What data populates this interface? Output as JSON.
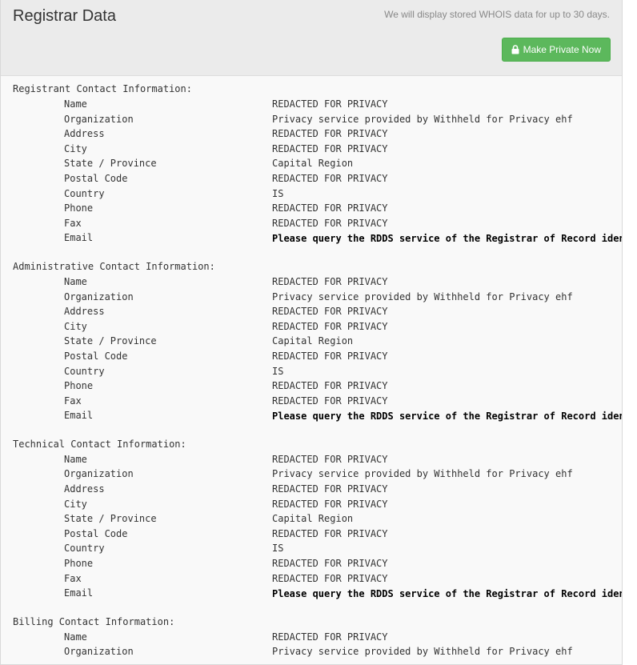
{
  "header": {
    "title": "Registrar Data",
    "note": "We will display stored WHOIS data for up to 30 days.",
    "button_label": "Make Private Now"
  },
  "sections": [
    {
      "title": "Registrant Contact Information:",
      "rows": [
        {
          "label": "Name",
          "value": "REDACTED FOR PRIVACY"
        },
        {
          "label": "Organization",
          "value": "Privacy service provided by Withheld for Privacy ehf"
        },
        {
          "label": "Address",
          "value": "REDACTED FOR PRIVACY"
        },
        {
          "label": "City",
          "value": "REDACTED FOR PRIVACY"
        },
        {
          "label": "State / Province",
          "value": "Capital Region"
        },
        {
          "label": "Postal Code",
          "value": "REDACTED FOR PRIVACY"
        },
        {
          "label": "Country",
          "value": "IS"
        },
        {
          "label": "Phone",
          "value": "REDACTED FOR PRIVACY"
        },
        {
          "label": "Fax",
          "value": "REDACTED FOR PRIVACY"
        },
        {
          "label": "Email",
          "value": "Please query the RDDS service of the Registrar of Record identifi"
        }
      ]
    },
    {
      "title": "Administrative Contact Information:",
      "rows": [
        {
          "label": "Name",
          "value": "REDACTED FOR PRIVACY"
        },
        {
          "label": "Organization",
          "value": "Privacy service provided by Withheld for Privacy ehf"
        },
        {
          "label": "Address",
          "value": "REDACTED FOR PRIVACY"
        },
        {
          "label": "City",
          "value": "REDACTED FOR PRIVACY"
        },
        {
          "label": "State / Province",
          "value": "Capital Region"
        },
        {
          "label": "Postal Code",
          "value": "REDACTED FOR PRIVACY"
        },
        {
          "label": "Country",
          "value": "IS"
        },
        {
          "label": "Phone",
          "value": "REDACTED FOR PRIVACY"
        },
        {
          "label": "Fax",
          "value": "REDACTED FOR PRIVACY"
        },
        {
          "label": "Email",
          "value": "Please query the RDDS service of the Registrar of Record identifi"
        }
      ]
    },
    {
      "title": "Technical Contact Information:",
      "rows": [
        {
          "label": "Name",
          "value": "REDACTED FOR PRIVACY"
        },
        {
          "label": "Organization",
          "value": "Privacy service provided by Withheld for Privacy ehf"
        },
        {
          "label": "Address",
          "value": "REDACTED FOR PRIVACY"
        },
        {
          "label": "City",
          "value": "REDACTED FOR PRIVACY"
        },
        {
          "label": "State / Province",
          "value": "Capital Region"
        },
        {
          "label": "Postal Code",
          "value": "REDACTED FOR PRIVACY"
        },
        {
          "label": "Country",
          "value": "IS"
        },
        {
          "label": "Phone",
          "value": "REDACTED FOR PRIVACY"
        },
        {
          "label": "Fax",
          "value": "REDACTED FOR PRIVACY"
        },
        {
          "label": "Email",
          "value": "Please query the RDDS service of the Registrar of Record identifi"
        }
      ]
    },
    {
      "title": "Billing Contact Information:",
      "rows": [
        {
          "label": "Name",
          "value": "REDACTED FOR PRIVACY"
        },
        {
          "label": "Organization",
          "value": "Privacy service provided by Withheld for Privacy ehf"
        }
      ]
    }
  ],
  "colors": {
    "button": "#5cb85c",
    "header_bg": "#ebebeb",
    "panel_bg": "#f9f9f9"
  },
  "icons": {
    "button_icon": "lock-icon"
  }
}
